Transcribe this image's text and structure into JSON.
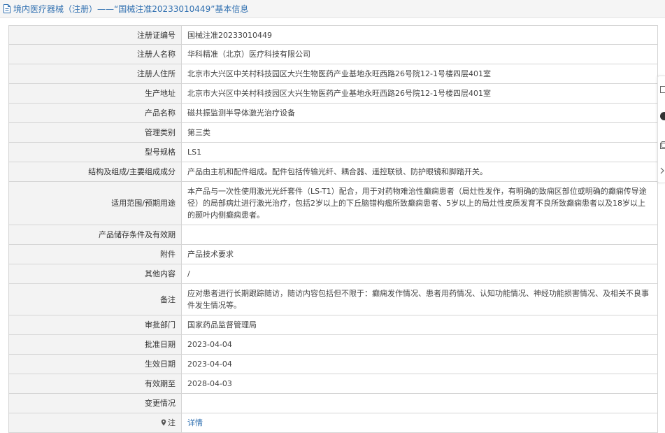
{
  "header": {
    "title": "境内医疗器械（注册）——“国械注准20233010449”基本信息",
    "icon": "document-icon"
  },
  "rows": [
    {
      "label": "注册证编号",
      "value": "国械注准20233010449"
    },
    {
      "label": "注册人名称",
      "value": "华科精准（北京）医疗科技有限公司"
    },
    {
      "label": "注册人住所",
      "value": "北京市大兴区中关村科技园区大兴生物医药产业基地永旺西路26号院12-1号楼四层401室"
    },
    {
      "label": "生产地址",
      "value": "北京市大兴区中关村科技园区大兴生物医药产业基地永旺西路26号院12-1号楼四层401室"
    },
    {
      "label": "产品名称",
      "value": "磁共振监测半导体激光治疗设备"
    },
    {
      "label": "管理类别",
      "value": "第三类"
    },
    {
      "label": "型号规格",
      "value": "LS1"
    },
    {
      "label": "结构及组成/主要组成成分",
      "value": "产品由主机和配件组成。配件包括传输光纤、耦合器、遥控联锁、防护眼镜和脚踏开关。"
    },
    {
      "label": "适用范围/预期用途",
      "value": "本产品与一次性使用激光光纤套件（LS-T1）配合，用于对药物难治性癫痫患者（局灶性发作，有明确的致痫区部位或明确的癫痫传导途径）的局部病灶进行激光治疗，包括2岁以上的下丘脑错构瘤所致癫痫患者、5岁以上的局灶性皮质发育不良所致癫痫患者以及18岁以上的颞叶内侧癫痫患者。"
    },
    {
      "label": "产品储存条件及有效期",
      "value": ""
    },
    {
      "label": "附件",
      "value": "产品技术要求"
    },
    {
      "label": "其他内容",
      "value": "/"
    },
    {
      "label": "备注",
      "value": "应对患者进行长期跟踪随访，随访内容包括但不限于：癫痫发作情况、患者用药情况、认知功能情况、神经功能损害情况、及相关不良事件发生情况等。"
    },
    {
      "label": "审批部门",
      "value": "国家药品监督管理局"
    },
    {
      "label": "批准日期",
      "value": "2023-04-04"
    },
    {
      "label": "生效日期",
      "value": "2023-04-04"
    },
    {
      "label": "有效期至",
      "value": "2028-04-03"
    },
    {
      "label": "变更情况",
      "value": ""
    }
  ],
  "note": {
    "label": "注",
    "link": "详情",
    "icon": "pin-icon"
  },
  "colors": {
    "link": "#2f6fb0",
    "label_bg": "#f3f3f3",
    "border": "#d5d5d5"
  }
}
